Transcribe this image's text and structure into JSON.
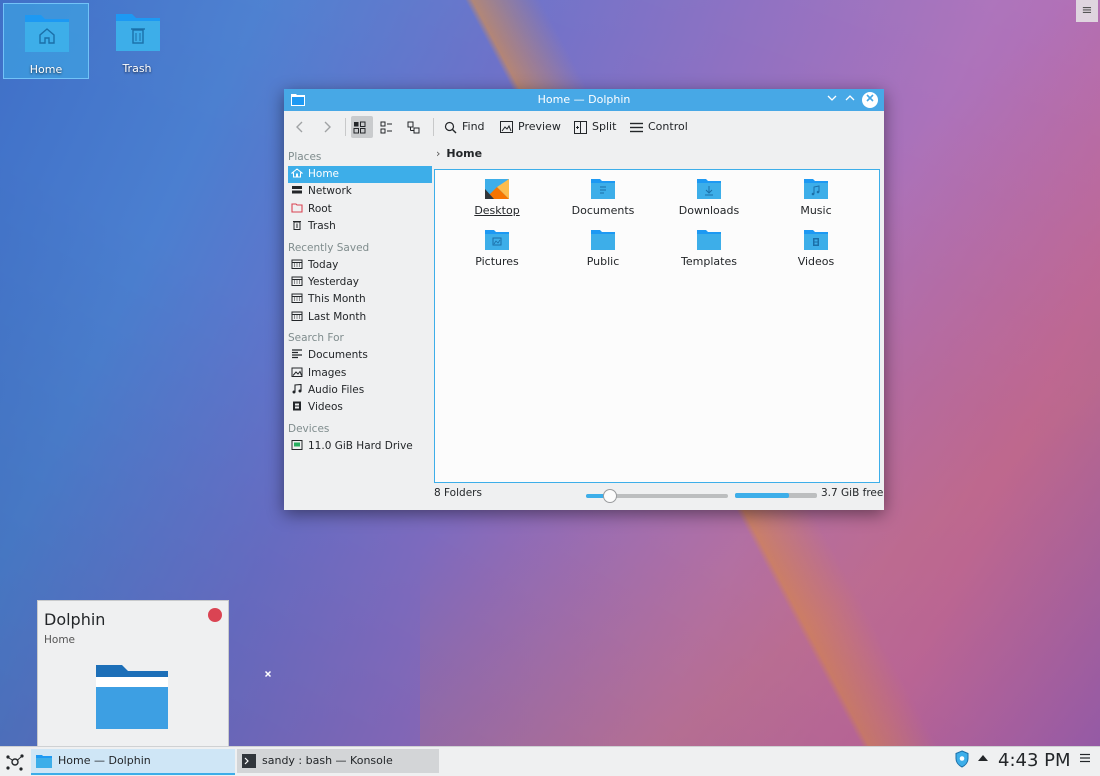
{
  "desktop": {
    "icons": [
      {
        "label": "Home"
      },
      {
        "label": "Trash"
      }
    ],
    "corner_menu": "≡"
  },
  "window": {
    "title": "Home — Dolphin",
    "toolbar": {
      "find": "Find",
      "preview": "Preview",
      "split": "Split",
      "control": "Control"
    },
    "places": {
      "sections": [
        {
          "title": "Places",
          "items": [
            "Home",
            "Network",
            "Root",
            "Trash"
          ]
        },
        {
          "title": "Recently Saved",
          "items": [
            "Today",
            "Yesterday",
            "This Month",
            "Last Month"
          ]
        },
        {
          "title": "Search For",
          "items": [
            "Documents",
            "Images",
            "Audio Files",
            "Videos"
          ]
        },
        {
          "title": "Devices",
          "items": [
            "11.0 GiB Hard Drive"
          ]
        }
      ],
      "selected": "Home"
    },
    "breadcrumb": "Home",
    "files": [
      "Desktop",
      "Documents",
      "Downloads",
      "Music",
      "Pictures",
      "Public",
      "Templates",
      "Videos"
    ],
    "status": {
      "count": "8 Folders",
      "zoom_level": 0.16,
      "space_used_fraction": 0.66,
      "free_space": "3.7 GiB free"
    }
  },
  "preview_popup": {
    "title": "Dolphin",
    "subtitle": "Home"
  },
  "taskbar": {
    "tasks": [
      "Home — Dolphin",
      "sandy : bash — Konsole"
    ],
    "clock": "4:43 PM"
  },
  "colors": {
    "accent": "#3daee9",
    "titlebar": "#47a8e6",
    "close_red": "#da4453"
  }
}
